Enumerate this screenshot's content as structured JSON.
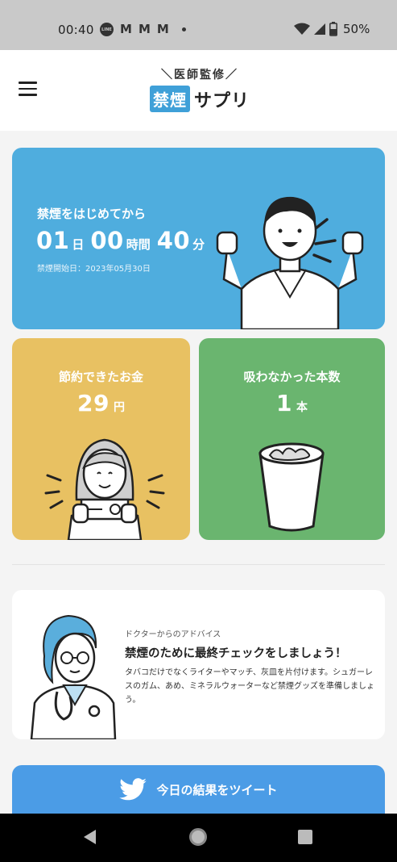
{
  "status_bar": {
    "time": "00:40",
    "line_icon_text": "LINE",
    "gmail_icons": [
      "M",
      "M",
      "M"
    ],
    "battery": "50%"
  },
  "header": {
    "logo_sub": "＼医師監修／",
    "logo_kinen": "禁煙",
    "logo_sapuri": "サプリ",
    "menu_icon": "hamburger-icon"
  },
  "main_card": {
    "label": "禁煙をはじめてから",
    "days": "01",
    "days_unit": "日",
    "hours": "00",
    "hours_unit": "時間",
    "minutes": "40",
    "minutes_unit": "分",
    "start_date": "禁煙開始日：2023年05月30日",
    "color": "#4fadde"
  },
  "savings_card": {
    "label": "節約できたお金",
    "value": "29",
    "unit": "円",
    "color": "#e8c162"
  },
  "cigarettes_card": {
    "label": "吸わなかった本数",
    "value": "1",
    "unit": "本",
    "color": "#6ab56f"
  },
  "advice": {
    "kicker": "ドクターからのアドバイス",
    "title": "禁煙のために最終チェックをしましょう！",
    "body": "タバコだけでなくライターやマッチ、灰皿を片付けます。シュガーレスのガム、あめ、ミネラルウォーターなど禁煙グッズを準備しましょう。"
  },
  "tweet_button": {
    "label": "今日の結果をツイート",
    "icon": "twitter-bird-icon",
    "color": "#4b9ce6"
  },
  "nav_bar": {
    "back_icon": "back-triangle-icon",
    "home_icon": "home-circle-icon",
    "recents_icon": "recents-square-icon"
  }
}
